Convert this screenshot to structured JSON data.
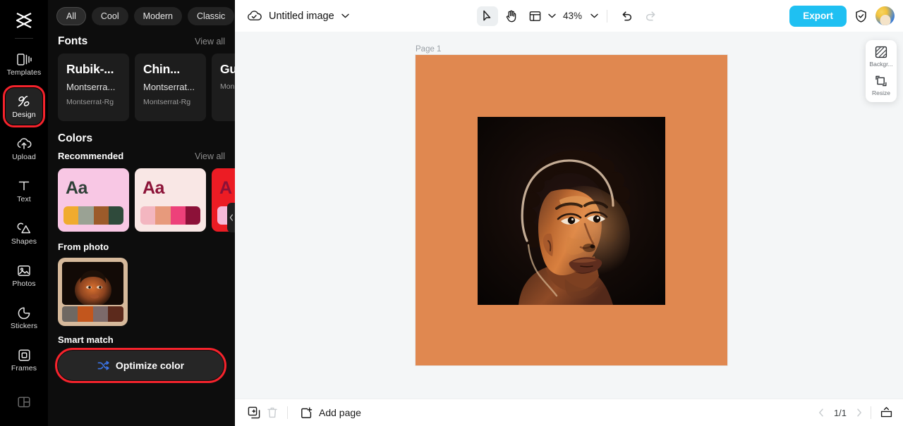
{
  "rail": {
    "logo_icon": "capcut-logo-icon",
    "items": [
      {
        "label": "Templates",
        "icon": "templates-icon",
        "active": false
      },
      {
        "label": "Design",
        "icon": "design-icon",
        "active": true,
        "highlighted": true
      },
      {
        "label": "Upload",
        "icon": "upload-cloud-icon",
        "active": false
      },
      {
        "label": "Text",
        "icon": "text-icon",
        "active": false
      },
      {
        "label": "Shapes",
        "icon": "shapes-icon",
        "active": false
      },
      {
        "label": "Photos",
        "icon": "photos-icon",
        "active": false
      },
      {
        "label": "Stickers",
        "icon": "stickers-icon",
        "active": false
      },
      {
        "label": "Frames",
        "icon": "frames-icon",
        "active": false
      }
    ]
  },
  "panel": {
    "chips": [
      {
        "label": "All",
        "active": true
      },
      {
        "label": "Cool",
        "active": false
      },
      {
        "label": "Modern",
        "active": false
      },
      {
        "label": "Classic",
        "active": false
      }
    ],
    "chip_more_icon": "chevron-down-icon",
    "fonts": {
      "title": "Fonts",
      "view_all": "View all",
      "cards": [
        {
          "line1": "Rubik-...",
          "line2": "Montserra...",
          "line3": "Montserrat-Rg"
        },
        {
          "line1": "Chin...",
          "line2": "Montserrat...",
          "line3": "Montserrat-Rg"
        },
        {
          "line1": "Gu",
          "line2": "",
          "line3": "Mon"
        }
      ],
      "next_icon": "chevron-right-icon"
    },
    "colors": {
      "title": "Colors",
      "recommended_label": "Recommended",
      "view_all": "View all",
      "palettes": [
        {
          "aa_text": "Aa",
          "bg": "#f8c7e4",
          "aa_color": "#2f4038",
          "swatches": [
            "#f0ab2e",
            "#9aa294",
            "#9c5b2a",
            "#2f4a3b"
          ]
        },
        {
          "aa_text": "Aa",
          "bg": "#f9e7e5",
          "aa_color": "#8c1338",
          "swatches": [
            "#f3b6c0",
            "#e79a7c",
            "#ed417a",
            "#8c1138"
          ]
        },
        {
          "aa_text": "A",
          "bg": "#ec1c24",
          "aa_color": "#8c1138",
          "swatches": [
            "#f6b9d8",
            "#f6b9d8",
            "#f6b9d8",
            "#f6b9d8"
          ]
        }
      ],
      "next_icon": "chevron-right-icon"
    },
    "from_photo": {
      "title": "From photo",
      "card_border": "#d6b99b",
      "swatches": [
        "#6f6862",
        "#c2561d",
        "#7c6a6a",
        "#5c2a1c"
      ]
    },
    "smart_match": {
      "title": "Smart match",
      "button_label": "Optimize color",
      "button_icon": "shuffle-icon",
      "highlighted": true
    },
    "collapse_handle_icon": "chevron-left-icon"
  },
  "topbar": {
    "cloud_icon": "cloud-check-icon",
    "doc_title": "Untitled image",
    "title_chevron_icon": "chevron-down-icon",
    "tools": [
      {
        "name": "select-tool",
        "icon": "cursor-arrow-icon",
        "active": true
      },
      {
        "name": "hand-tool",
        "icon": "hand-icon",
        "active": false
      },
      {
        "name": "layout-tool",
        "icon": "layout-grid-icon",
        "active": false
      }
    ],
    "layout_chevron_icon": "chevron-down-icon",
    "zoom_value": "43%",
    "zoom_chevron_icon": "chevron-down-icon",
    "undo_icon": "undo-icon",
    "redo_icon": "redo-icon",
    "redo_disabled": true,
    "export_label": "Export",
    "shield_icon": "shield-check-icon",
    "avatar": "user-avatar"
  },
  "canvas": {
    "page_label": "Page 1",
    "page_background": "#e08850",
    "photo_alt": "portrait-photo"
  },
  "right_panel": {
    "items": [
      {
        "label": "Backgr...",
        "icon": "background-hatch-icon"
      },
      {
        "label": "Resize",
        "icon": "resize-icon"
      }
    ]
  },
  "bottombar": {
    "duplicate_icon": "duplicate-page-icon",
    "delete_icon": "trash-icon",
    "delete_disabled": true,
    "add_page_label": "Add page",
    "add_page_icon": "add-page-icon",
    "prev_icon": "chevron-left-icon",
    "page_indicator": "1/1",
    "next_icon": "chevron-right-icon",
    "present_icon": "present-icon"
  },
  "colors": {
    "accent": "#1fc0f2",
    "highlight_ring": "#f5232c",
    "panel_bg": "#0d0d0d",
    "rail_bg": "#000000",
    "canvas_bg": "#f4f6f7"
  }
}
